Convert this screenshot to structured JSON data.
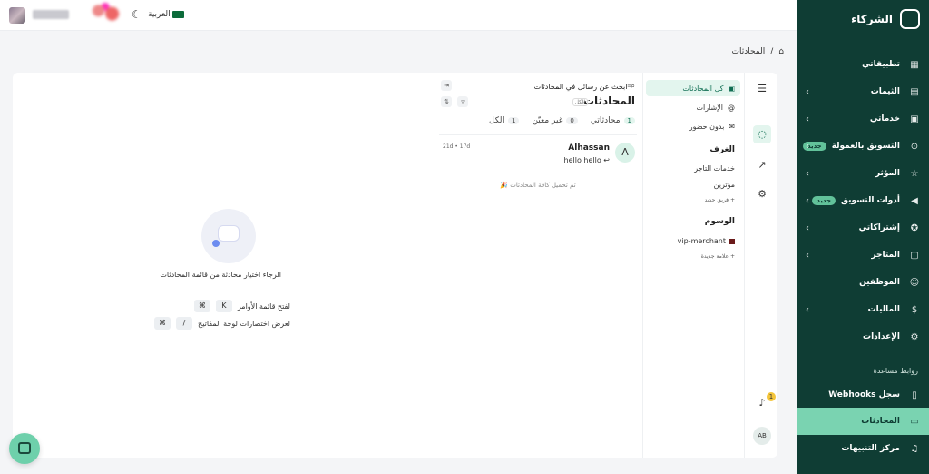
{
  "topbar": {
    "language": "العربية",
    "theme_icon": "moon-icon"
  },
  "sidebar": {
    "brand": "الشركاء",
    "items": [
      {
        "label": "تطبيقاتي",
        "icon": "grid-icon"
      },
      {
        "label": "الثيمات",
        "icon": "layout-icon",
        "chevron": "›"
      },
      {
        "label": "خدماتي",
        "icon": "briefcase-icon",
        "chevron": "›"
      },
      {
        "label": "التسويق بالعمولة",
        "icon": "link-icon",
        "chevron": "›",
        "badge": "جديد"
      },
      {
        "label": "المؤثر",
        "icon": "star-icon",
        "chevron": "›"
      },
      {
        "label": "أدوات التسويق",
        "icon": "megaphone-icon",
        "chevron": "›",
        "badge": "جديد"
      },
      {
        "label": "إشتراكاتي",
        "icon": "award-icon",
        "chevron": "›"
      },
      {
        "label": "المتاجر",
        "icon": "store-icon",
        "chevron": "›"
      },
      {
        "label": "الموظفين",
        "icon": "users-icon"
      },
      {
        "label": "الماليات",
        "icon": "dollar-icon",
        "chevron": "›"
      },
      {
        "label": "الإعدادات",
        "icon": "gear-icon"
      }
    ],
    "help_section": "روابط مساعدة",
    "help_items": [
      {
        "label": "سجل Webhooks",
        "icon": "document-icon"
      },
      {
        "label": "المحادثات",
        "icon": "chat-icon",
        "active": true
      },
      {
        "label": "مركز التنبيهات",
        "icon": "bell-icon"
      }
    ]
  },
  "breadcrumb": {
    "current": "المحادثات",
    "separator": "/"
  },
  "folders": {
    "items": [
      {
        "label": "كل المحادثات",
        "active": true
      },
      {
        "label": "الإشارات"
      },
      {
        "label": "بدون حضور"
      }
    ],
    "teams_title": "الغرف",
    "teams": [
      "خدمات التاجر",
      "مؤثرين"
    ],
    "add_team": "فريق جديد",
    "labels_title": "الوسوم",
    "labels": [
      "vip-merchant"
    ],
    "add_label": "علامة جديدة"
  },
  "conversations": {
    "search_placeholder": "ابحث عن رسائل في المحادثات",
    "title": "المحادثات",
    "count_badge": "الكل",
    "tabs": [
      {
        "label": "محادثاتي",
        "count": "1"
      },
      {
        "label": "غير معيّن",
        "count": "0"
      },
      {
        "label": "الكل",
        "count": "1"
      }
    ],
    "rows": [
      {
        "name": "Alhassan",
        "avatar": "A",
        "message": "hello hello",
        "time": "21d • 17d"
      }
    ],
    "all_loaded": "تم تحميل كافة المحادثات 🎉"
  },
  "empty_state": {
    "message": "الرجاء اختيار محادثة من قائمة المحادثات",
    "shortcuts": [
      {
        "keys": [
          "⌘",
          "K"
        ],
        "label": "لفتح قائمة الأوامر"
      },
      {
        "keys": [
          "⌘",
          "/"
        ],
        "label": "لعرض اختصارات لوحة المفاتيح"
      }
    ]
  },
  "rail": {
    "notification_count": "1",
    "user_initials": "AB"
  }
}
